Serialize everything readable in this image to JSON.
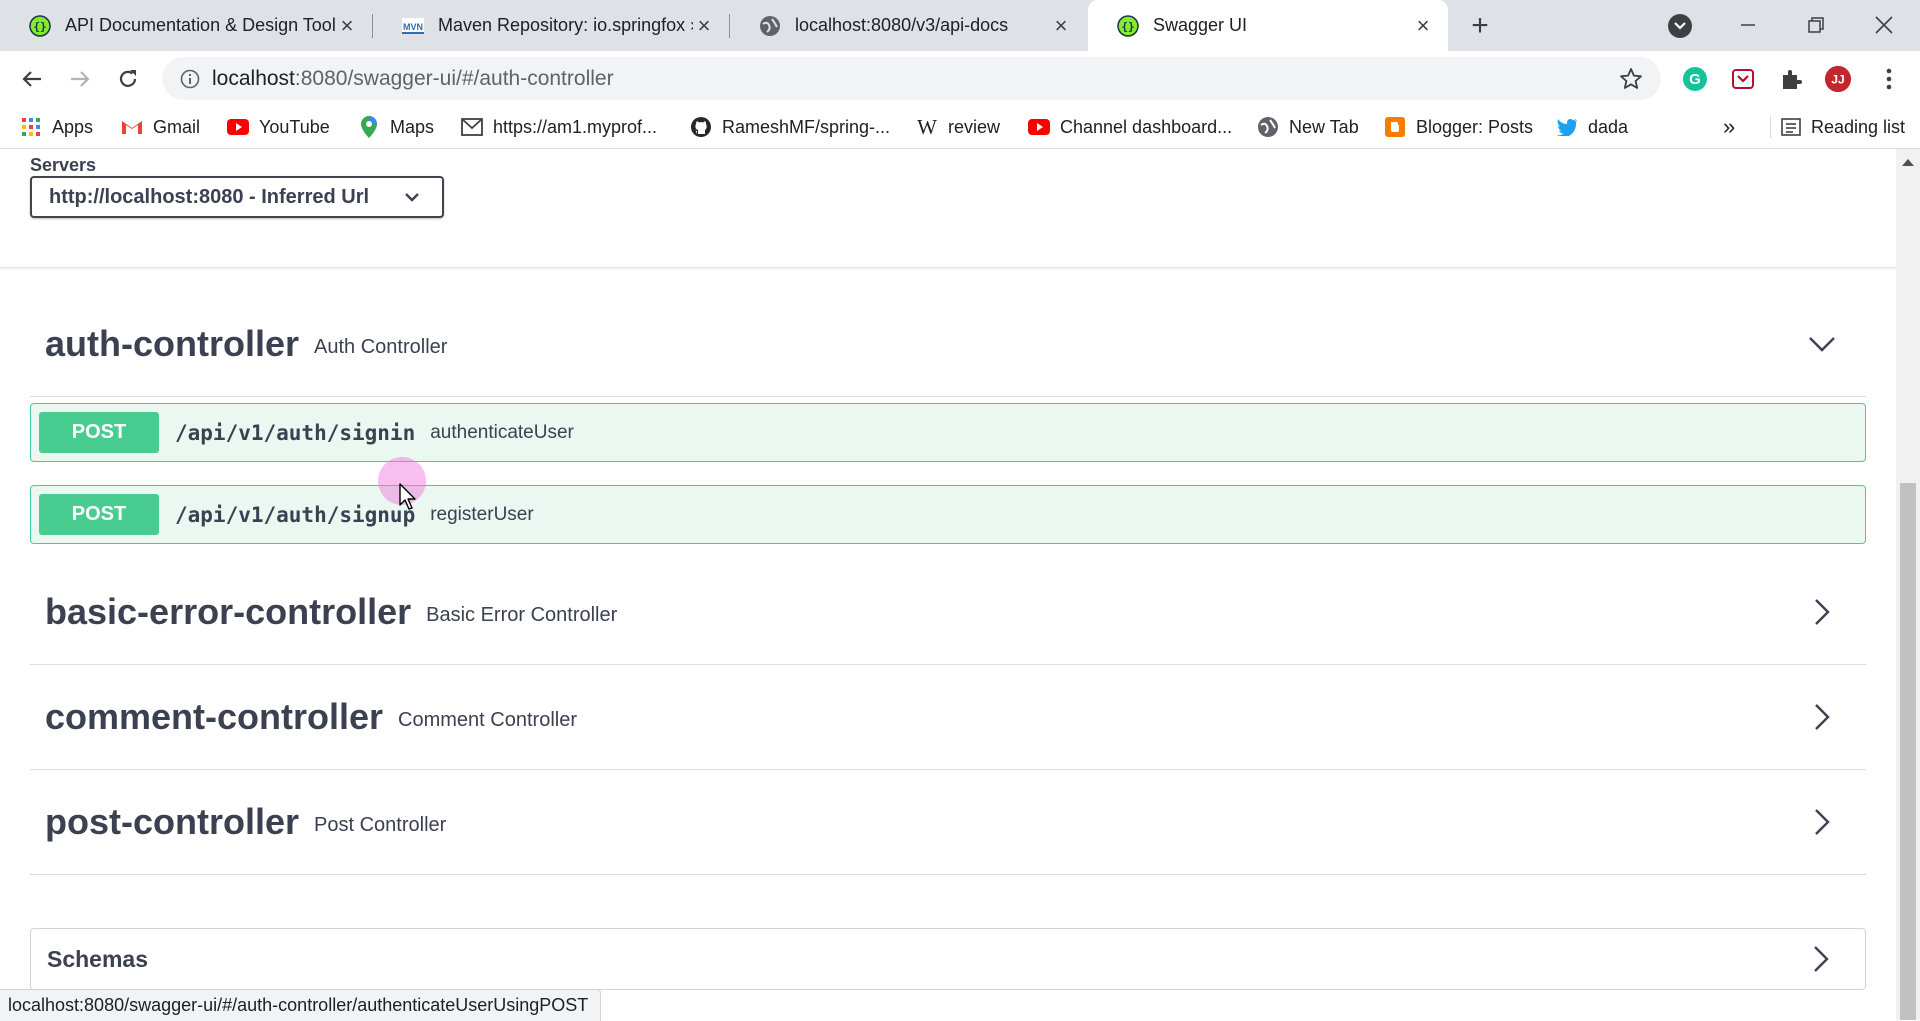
{
  "browser": {
    "tabs": [
      {
        "title": "API Documentation & Design Tools",
        "icon": "swagger-icon",
        "active": false
      },
      {
        "title": "Maven Repository: io.springfox » springfox",
        "icon": "mvn-icon",
        "active": false
      },
      {
        "title": "localhost:8080/v3/api-docs",
        "icon": "globe-icon",
        "active": false
      },
      {
        "title": "Swagger UI",
        "icon": "swagger-icon",
        "active": true
      }
    ],
    "address": {
      "host": "localhost",
      "rest": ":8080/swagger-ui/#/auth-controller"
    },
    "bookmarks": [
      {
        "label": "Apps",
        "icon": "apps-grid-icon"
      },
      {
        "label": "Gmail",
        "icon": "gmail-icon"
      },
      {
        "label": "YouTube",
        "icon": "youtube-icon"
      },
      {
        "label": "Maps",
        "icon": "maps-pin-icon"
      },
      {
        "label": "https://am1.myprof...",
        "icon": "mail-envelope-icon"
      },
      {
        "label": "RameshMF/spring-...",
        "icon": "github-icon"
      },
      {
        "label": "review",
        "icon": "wikipedia-icon"
      },
      {
        "label": "Channel dashboard...",
        "icon": "youtube-icon"
      },
      {
        "label": "New Tab",
        "icon": "globe-icon"
      },
      {
        "label": "Blogger: Posts",
        "icon": "blogger-icon"
      },
      {
        "label": "dada",
        "icon": "twitter-icon"
      }
    ],
    "more_bookmarks": "»",
    "reading_list": "Reading list",
    "profile_initials": "JJ",
    "colors": {
      "tab_strip": "#dee1e6",
      "omnibox": "#f1f3f4"
    }
  },
  "swagger": {
    "servers_label": "Servers",
    "server_selected": "http://localhost:8080 - Inferred Url",
    "tags": [
      {
        "name": "auth-controller",
        "description": "Auth Controller",
        "expanded": true,
        "operations": [
          {
            "method": "POST",
            "path": "/api/v1/auth/signin",
            "summary": "authenticateUser"
          },
          {
            "method": "POST",
            "path": "/api/v1/auth/signup",
            "summary": "registerUser"
          }
        ]
      },
      {
        "name": "basic-error-controller",
        "description": "Basic Error Controller",
        "expanded": false
      },
      {
        "name": "comment-controller",
        "description": "Comment Controller",
        "expanded": false
      },
      {
        "name": "post-controller",
        "description": "Post Controller",
        "expanded": false
      }
    ],
    "schemas_label": "Schemas",
    "colors": {
      "post": "#49cc90",
      "post_bg": "#ebf7f1",
      "text": "#3b4151"
    }
  },
  "status_url": "localhost:8080/swagger-ui/#/auth-controller/authenticateUserUsingPOST"
}
